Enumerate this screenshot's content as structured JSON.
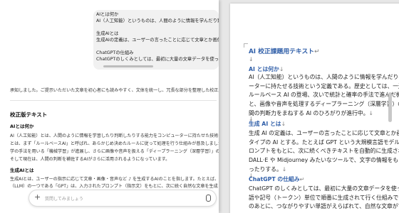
{
  "chat": {
    "bubble_lines": [
      "AIとは何か",
      "AI（人工知能）というものは、人間のように情報を学んだり判断",
      "",
      "生成AIとは",
      "生成AIの定義は、ユーザーの言ったことに応じて文章とか画像や",
      "",
      "ChatGPTの仕組み",
      "ChatGPTのしくみとしては、最初に大量の文章データを使って学習"
    ],
    "intro": "承知しました。ご提示いただいた文章を初心者にも読みやすく、文体を統一し、冗長な部分を整理した校正版を作",
    "heading": "校正版テキスト",
    "sections": [
      {
        "title": "AIとは何か",
        "lines": [
          "AI（人工知能）とは、人間のように情報を学習したり判断したりする能力をコンピューターに持たせた技術のこ",
          "とは、まず「ルールベースAI」と呼ばれ、あらかじめ決めたルールに従って処理を行う仕組みが普及しました。その",
          "学の手法を用いる「機械学習」が進展し、さらに画像や音声を扱える「ディープラーニング（深層学習）」の時代に移り",
          "そして現在は、人間の判断を補佐するAIがさらに活用されるようになっています。"
        ]
      },
      {
        "title": "生成AIとは",
        "lines": [
          "生成AIとは、ユーザーの指示に応じて文章・画像・音声など  ♪  を生成するAIのことを指します。たとえば、大規模",
          "（LLM）の一つである「GPT」は、入力されたプロンプト（指示文）をもとに、次に続く自然な文章を生成します。"
        ]
      }
    ],
    "input_placeholder": "質問してみましょう"
  },
  "doc": {
    "lines": [
      {
        "text": "AI 校正課題用テキスト",
        "style": "blue title",
        "mark": "↵"
      },
      {
        "text": "",
        "style": "",
        "mark": "↓"
      },
      {
        "text": "AI とは何か",
        "style": "blue",
        "mark": "↓"
      },
      {
        "text": "AI（人工知能）というものは、人間のように情報を学んだり判断す",
        "style": "",
        "mark": ""
      },
      {
        "text": "ーターに持たせる技術という定義である。歴史としては、一連のル",
        "style": "",
        "mark": ""
      },
      {
        "text": "ルールベース AI の登場、次いで統計と確率の手法で進んだ機械学",
        "style": "",
        "mark": ""
      },
      {
        "text": "と、画像や音声を処理するディープラーニング（深層学習）の時",
        "style": "",
        "mark": ""
      },
      {
        "text": "間の判断力をまねする AI のひろがりが進行中。",
        "style": "",
        "mark": "↓"
      },
      {
        "text": "",
        "style": "",
        "mark": "↓"
      },
      {
        "text": "生成 AI とは",
        "style": "blue",
        "mark": "↓"
      },
      {
        "text": "生成 AI の定義は、ユーザーの言ったことに応じて文章とか画像や",
        "style": "",
        "mark": ""
      },
      {
        "text": "タイプの AI とする。たとえば GPT という大規模言語モデル（LLM",
        "style": "",
        "mark": ""
      },
      {
        "text": "ロンプトをもとに、次に続くべきテキストを自動的に生成されるも",
        "style": "",
        "mark": ""
      },
      {
        "text": "DALL·E や Midjourney みたいなツールで、文字の情報をもとにイ",
        "style": "",
        "mark": ""
      },
      {
        "text": "ったりする。",
        "style": "",
        "mark": "↓"
      },
      {
        "text": "",
        "style": "",
        "mark": "↓"
      },
      {
        "text": "ChatGPT の仕組み",
        "style": "blue",
        "mark": "↵"
      },
      {
        "text": "ChatGPT のしくみとしては、最初に大量の文章データを使って学",
        "style": "",
        "mark": ""
      },
      {
        "text": "語や記号（トークン）単位で順番に生成されて行く仕組みである。",
        "style": "",
        "mark": ""
      },
      {
        "text": "のあとに、つながりやすい単語がえらばれて、自然な文章ができあ",
        "style": "",
        "mark": ""
      }
    ]
  }
}
